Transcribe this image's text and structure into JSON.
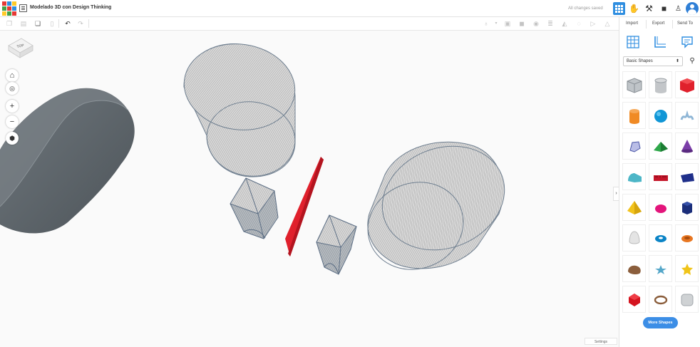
{
  "header": {
    "title": "Modelado 3D con Design Thinking",
    "save_status": "All changes saved",
    "logo_colors": [
      "#e53935",
      "#2f8ee0",
      "#ffca28",
      "#43a047",
      "#e53935",
      "#2f8ee0",
      "#ffca28",
      "#43a047",
      "#e53935"
    ]
  },
  "toolbar": {
    "left_icons": [
      "copy-icon",
      "paste-icon",
      "duplicate-icon",
      "delete-icon",
      "undo-icon",
      "redo-icon"
    ],
    "right_icons": [
      "light-bulb-icon",
      "group-icon",
      "ungroup-icon",
      "align-icon",
      "mirror-icon",
      "flip-icon",
      "hide-icon",
      "show-icon"
    ]
  },
  "panel": {
    "tabs": [
      "Import",
      "Export",
      "Send To"
    ],
    "view_icons": [
      "workplane-grid-icon",
      "ruler-icon",
      "notes-icon"
    ],
    "shape_category": "Basic Shapes",
    "more_shapes_label": "More Shapes",
    "shapes": [
      "box-striped",
      "cylinder-striped",
      "box",
      "cylinder",
      "sphere",
      "scribble",
      "polygon",
      "roof",
      "cone",
      "round-roof",
      "text",
      "half-sphere",
      "pyramid",
      "paraboloid",
      "hexagonal-prism",
      "egg",
      "torus",
      "tube",
      "rock",
      "starfish",
      "star",
      "icosahedron",
      "ring",
      "round-box"
    ]
  },
  "viewport": {
    "view_cube_label": "TOP",
    "settings_label": "Settings",
    "shape_red": "#e0202c",
    "shape_dark": "#5a6268",
    "shape_hole": "#c8c8c8"
  }
}
